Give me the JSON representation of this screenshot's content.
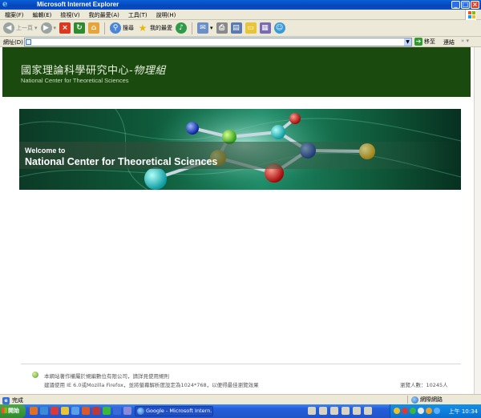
{
  "window": {
    "title": "Microsoft Internet Explorer",
    "buttons": [
      "_",
      "□",
      "×"
    ]
  },
  "menu": {
    "items": [
      "檔案(F)",
      "編輯(E)",
      "檢視(V)",
      "我的最愛(A)",
      "工具(T)",
      "說明(H)"
    ]
  },
  "toolbar": {
    "back_label": "上一頁",
    "search_label": "搜尋",
    "favorites_label": "我的最愛"
  },
  "address": {
    "label": "網址(D)",
    "value": "",
    "go_label": "移至",
    "links_label": "連結"
  },
  "page": {
    "header_title_zh": "國家理論科學研究中心-",
    "header_title_zh_italic": "物理組",
    "header_title_en": "National Center for Theoretical Sciences",
    "banner_welcome": "Welcome to",
    "banner_title": "National Center for Theoretical Sciences",
    "footer_line1": "本網站著作權屬於規編數位有限公司，請詳見使用規則",
    "footer_line2": "建議使用 IE 6.0或Mozilla Firefox，並將螢幕解析度設定為1024*768，以便得最佳瀏覽效果",
    "visit_count": "瀏覽人數：10245人"
  },
  "status": {
    "text": "完成",
    "zone": "網際網路"
  },
  "taskbar": {
    "start_label": "開始",
    "task_label": "Google - Microsoft Intern...",
    "clock": "上午 10:34"
  },
  "colors": {
    "header_bg": "#1a4a0e",
    "banner_teal": "#1d8a66"
  }
}
